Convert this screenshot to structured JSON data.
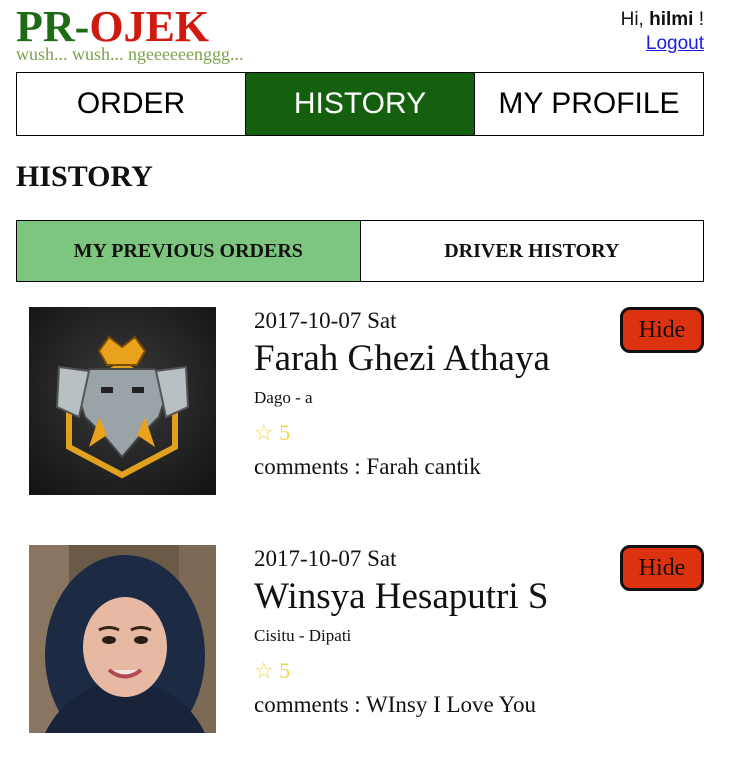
{
  "logo": {
    "pr": "PR-",
    "ojek": "OJEK",
    "tagline": "wush... wush... ngeeeeeenggg..."
  },
  "user": {
    "greeting": "Hi, ",
    "name": "hilmi",
    "suffix": " !",
    "logout": "Logout"
  },
  "nav": {
    "tabs": [
      "ORDER",
      "HISTORY",
      "MY PROFILE"
    ],
    "active": "HISTORY"
  },
  "page": {
    "title": "HISTORY"
  },
  "subtabs": {
    "previous": "MY PREVIOUS ORDERS",
    "driver": "DRIVER HISTORY",
    "active": "MY PREVIOUS ORDERS"
  },
  "orders": [
    {
      "date": "2017-10-07 Sat",
      "name": "Farah Ghezi Athaya",
      "route": "Dago - a",
      "rating": "☆ 5",
      "comment": "comments : Farah cantik",
      "hide": "Hide",
      "photo_icon": "emblem-logo-image"
    },
    {
      "date": "2017-10-07 Sat",
      "name": "Winsya Hesaputri S",
      "route": "Cisitu - Dipati",
      "rating": "☆ 5",
      "comment": "comments : WInsy I Love You",
      "hide": "Hide",
      "photo_icon": "portrait-image"
    }
  ],
  "colors": {
    "brand_green": "#1f6b15",
    "brand_red": "#d01a10",
    "tagline": "#7ba24a",
    "active_tab": "#15600f",
    "active_subtab": "#7dc67f",
    "hide_button": "#dd3210",
    "rating_star": "#f2d64a"
  }
}
